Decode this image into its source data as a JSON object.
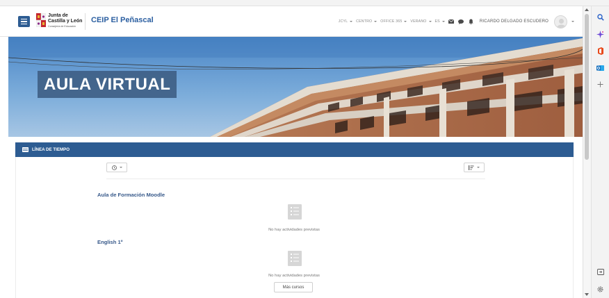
{
  "site": {
    "logo_line1": "Junta de",
    "logo_line2": "Castilla y León",
    "logo_line3": "Consejería de Educación",
    "name": "CEIP El Peñascal"
  },
  "nav": {
    "links": [
      "JCYL",
      "CENTRO",
      "OFFICE 365",
      "VERANO",
      "ES"
    ],
    "user_name": "RICARDO DELGADO ESCUDERO"
  },
  "banner": {
    "title": "AULA VIRTUAL"
  },
  "timeline": {
    "header": "LÍNEA DE TIEMPO",
    "courses": [
      {
        "name": "Aula de Formación Moodle",
        "empty_message": "No hay actividades previstas"
      },
      {
        "name": "English 1º",
        "empty_message": "No hay actividades previstas"
      }
    ],
    "more_label": "Más cursos"
  },
  "colors": {
    "primary": "#2d5c92",
    "link": "#37598a",
    "brand_text": "#2a5ea0"
  },
  "icons": {
    "menu": "hamburger-icon",
    "email": "envelope-icon",
    "chat": "chat-bubble-icon",
    "notifications": "bell-icon",
    "filter": "clock-icon",
    "sort": "sort-icon",
    "empty": "document-list-icon",
    "edge": [
      "search-icon",
      "sparkle-icon",
      "office-icon",
      "outlook-icon",
      "plus-icon",
      "sidebar-panel-icon",
      "settings-gear-icon"
    ]
  }
}
